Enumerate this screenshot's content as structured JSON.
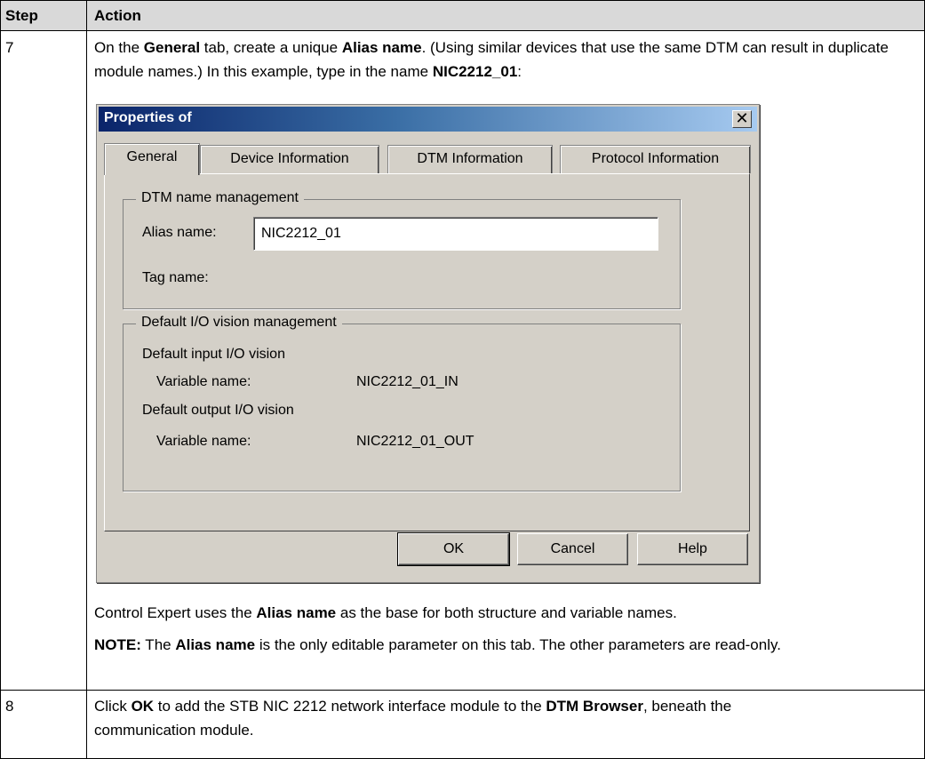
{
  "table": {
    "header": {
      "step": "Step",
      "action": "Action"
    },
    "row7": {
      "step": "7",
      "intro": {
        "p1": "On the ",
        "b1": "General",
        "p2": " tab, create a unique ",
        "b2": "Alias name",
        "p3": ". (Using similar devices that use the same DTM can result in duplicate module names.) In this example, type in the name ",
        "b3": "NIC2212_01",
        "p4": ":"
      },
      "note1": {
        "p1": "Control Expert uses the ",
        "b1": "Alias name",
        "p2": " as the base for both structure and variable names."
      },
      "note2": {
        "b0": "NOTE:",
        "p1": " The ",
        "b1": "Alias name",
        "p2": " is the only editable parameter on this tab. The other parameters are read-only."
      }
    },
    "row8": {
      "step": "8",
      "p1": "Click ",
      "b1": "OK",
      "p2": " to add the STB NIC 2212 network interface module to the ",
      "b2": "DTM Browser",
      "p3": ", beneath the communication module."
    }
  },
  "dialog": {
    "title": "Properties of",
    "close_glyph": "✕",
    "tabs": [
      "General",
      "Device Information",
      "DTM Information",
      "Protocol Information"
    ],
    "active_tab": "General",
    "dtm_group": {
      "legend": "DTM name management",
      "alias_label": "Alias name:",
      "alias_value": "NIC2212_01",
      "tag_label": "Tag name:"
    },
    "io_group": {
      "legend": "Default I/O vision management",
      "input_heading": "Default input I/O vision",
      "input_var_label": "Variable name:",
      "input_var_value": "NIC2212_01_IN",
      "output_heading": "Default output I/O vision",
      "output_var_label": "Variable name:",
      "output_var_value": "NIC2212_01_OUT"
    },
    "buttons": {
      "ok": "OK",
      "cancel": "Cancel",
      "help": "Help"
    }
  }
}
